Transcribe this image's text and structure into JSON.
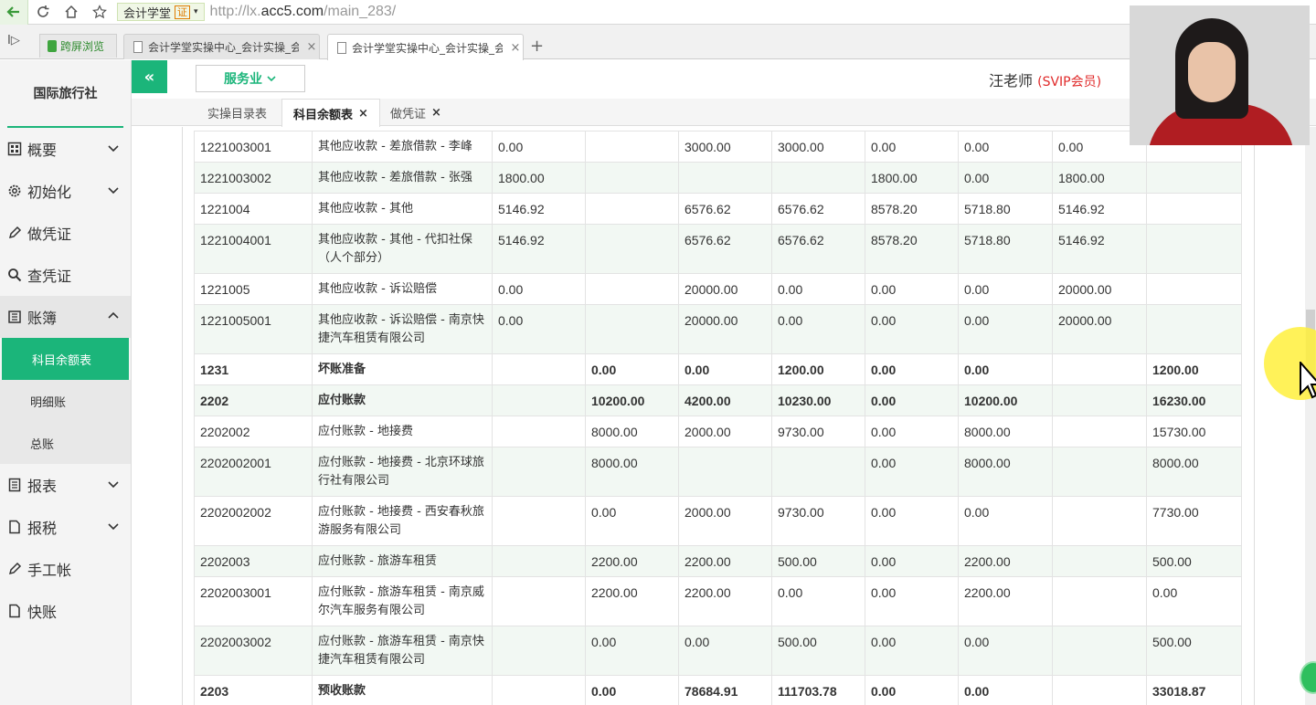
{
  "browser": {
    "site_label": "会计学堂",
    "cert_label": "证",
    "url_prefix": "http://lx.",
    "url_domain": "acc5.com",
    "url_path": "/main_283/",
    "lock_tab_label": "跨屏浏览",
    "tabs": [
      {
        "title": "会计学堂实操中心_会计实操_会计",
        "close": "×"
      },
      {
        "title": "会计学堂实操中心_会计实操_会",
        "close": "×"
      }
    ],
    "new_tab": "+"
  },
  "sidebar": {
    "company": "国际旅行社",
    "items": [
      {
        "label": "概要",
        "icon": "dashboard-icon",
        "chevron": true
      },
      {
        "label": "初始化",
        "icon": "gear-icon",
        "chevron": true
      },
      {
        "label": "做凭证",
        "icon": "pencil-icon",
        "chevron": false
      },
      {
        "label": "查凭证",
        "icon": "search-icon",
        "chevron": false
      },
      {
        "label": "账簿",
        "icon": "ledger-icon",
        "chevron": true,
        "open": true
      },
      {
        "label": "报表",
        "icon": "report-icon",
        "chevron": true
      },
      {
        "label": "报税",
        "icon": "document-icon",
        "chevron": true
      },
      {
        "label": "手工帐",
        "icon": "pencil-icon",
        "chevron": false
      },
      {
        "label": "快账",
        "icon": "document-icon",
        "chevron": false
      }
    ],
    "sub_items": [
      "科目余额表",
      "明细账",
      "总账"
    ]
  },
  "header": {
    "collapse_label": "«",
    "industry": "服务业",
    "user_name": "汪老师",
    "user_tag": "(SVIP会员)"
  },
  "subtabs": [
    {
      "label": "实操目录表",
      "closable": false
    },
    {
      "label": "科目余额表",
      "closable": true,
      "close": "×"
    },
    {
      "label": "做凭证",
      "closable": true,
      "close": "×"
    }
  ],
  "table": {
    "rows": [
      {
        "code": "1221003001",
        "name": "其他应收款 - 差旅借款 - 李峰",
        "v": [
          "0.00",
          "",
          "3000.00",
          "3000.00",
          "0.00",
          "0.00",
          "0.00",
          ""
        ],
        "bold": false
      },
      {
        "code": "1221003002",
        "name": "其他应收款 - 差旅借款 - 张强",
        "v": [
          "1800.00",
          "",
          "",
          "",
          "1800.00",
          "0.00",
          "1800.00",
          ""
        ],
        "bold": false
      },
      {
        "code": "1221004",
        "name": "其他应收款 - 其他",
        "v": [
          "5146.92",
          "",
          "6576.62",
          "6576.62",
          "8578.20",
          "5718.80",
          "5146.92",
          ""
        ],
        "bold": false
      },
      {
        "code": "1221004001",
        "name": "其他应收款 - 其他 - 代扣社保（人个部分）",
        "v": [
          "5146.92",
          "",
          "6576.62",
          "6576.62",
          "8578.20",
          "5718.80",
          "5146.92",
          ""
        ],
        "bold": false
      },
      {
        "code": "1221005",
        "name": "其他应收款 - 诉讼赔偿",
        "v": [
          "0.00",
          "",
          "20000.00",
          "0.00",
          "0.00",
          "0.00",
          "20000.00",
          ""
        ],
        "bold": false
      },
      {
        "code": "1221005001",
        "name": "其他应收款 - 诉讼赔偿 - 南京快捷汽车租赁有限公司",
        "v": [
          "0.00",
          "",
          "20000.00",
          "0.00",
          "0.00",
          "0.00",
          "20000.00",
          ""
        ],
        "bold": false
      },
      {
        "code": "1231",
        "name": "坏账准备",
        "v": [
          "",
          "0.00",
          "0.00",
          "1200.00",
          "0.00",
          "0.00",
          "",
          "1200.00"
        ],
        "bold": true
      },
      {
        "code": "2202",
        "name": "应付账款",
        "v": [
          "",
          "10200.00",
          "4200.00",
          "10230.00",
          "0.00",
          "10200.00",
          "",
          "16230.00"
        ],
        "bold": true
      },
      {
        "code": "2202002",
        "name": "应付账款 - 地接费",
        "v": [
          "",
          "8000.00",
          "2000.00",
          "9730.00",
          "0.00",
          "8000.00",
          "",
          "15730.00"
        ],
        "bold": false
      },
      {
        "code": "2202002001",
        "name": "应付账款 - 地接费 - 北京环球旅行社有限公司",
        "v": [
          "",
          "8000.00",
          "",
          "",
          "0.00",
          "8000.00",
          "",
          "8000.00"
        ],
        "bold": false
      },
      {
        "code": "2202002002",
        "name": "应付账款 - 地接费 - 西安春秋旅游服务有限公司",
        "v": [
          "",
          "0.00",
          "2000.00",
          "9730.00",
          "0.00",
          "0.00",
          "",
          "7730.00"
        ],
        "bold": false
      },
      {
        "code": "2202003",
        "name": "应付账款 - 旅游车租赁",
        "v": [
          "",
          "2200.00",
          "2200.00",
          "500.00",
          "0.00",
          "2200.00",
          "",
          "500.00"
        ],
        "bold": false
      },
      {
        "code": "2202003001",
        "name": "应付账款 - 旅游车租赁 - 南京威尔汽车服务有限公司",
        "v": [
          "",
          "2200.00",
          "2200.00",
          "0.00",
          "0.00",
          "2200.00",
          "",
          "0.00"
        ],
        "bold": false
      },
      {
        "code": "2202003002",
        "name": "应付账款 - 旅游车租赁 - 南京快捷汽车租赁有限公司",
        "v": [
          "",
          "0.00",
          "0.00",
          "500.00",
          "0.00",
          "0.00",
          "",
          "500.00"
        ],
        "bold": false
      },
      {
        "code": "2203",
        "name": "预收账款",
        "v": [
          "",
          "0.00",
          "78684.91",
          "111703.78",
          "0.00",
          "0.00",
          "",
          "33018.87"
        ],
        "bold": true
      }
    ]
  }
}
